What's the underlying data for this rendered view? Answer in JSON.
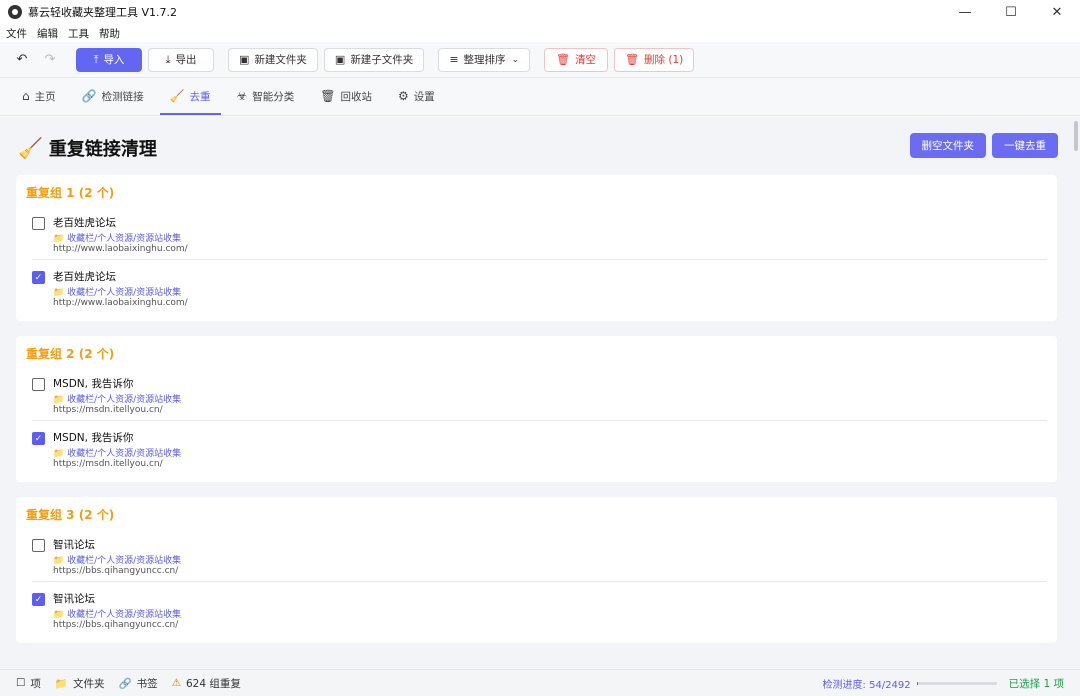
{
  "window": {
    "title": "慕云轻收藏夹整理工具 V1.7.2"
  },
  "menu": [
    "文件",
    "编辑",
    "工具",
    "帮助"
  ],
  "toolbar": {
    "undo": "↶",
    "redo": "↷",
    "import": "导入",
    "export": "导出",
    "new_folder": "新建文件夹",
    "new_subfolder": "新建子文件夹",
    "sort": "整理排序",
    "clear": "清空",
    "delete": "删除 (1)"
  },
  "tabs": [
    {
      "label": "主页",
      "icon": "home-icon"
    },
    {
      "label": "检测链接",
      "icon": "link-icon"
    },
    {
      "label": "去重",
      "icon": "broom-icon",
      "active": true
    },
    {
      "label": "智能分类",
      "icon": "robot-icon"
    },
    {
      "label": "回收站",
      "icon": "trash-icon"
    },
    {
      "label": "设置",
      "icon": "gear-icon"
    }
  ],
  "page": {
    "title": "重复链接清理",
    "delete_empty_button": "删空文件夹",
    "dedupe_button": "一键去重"
  },
  "groups": [
    {
      "title": "重复组 1 (2 个)",
      "items": [
        {
          "title": "老百姓虎论坛",
          "folder": "收藏栏/个人资源/资源站收集",
          "url": "http://www.laobaixinghu.com/",
          "checked": false
        },
        {
          "title": "老百姓虎论坛",
          "folder": "收藏栏/个人资源/资源站收集",
          "url": "http://www.laobaixinghu.com/",
          "checked": true
        }
      ]
    },
    {
      "title": "重复组 2 (2 个)",
      "items": [
        {
          "title": "MSDN, 我告诉你",
          "folder": "收藏栏/个人资源/资源站收集",
          "url": "https://msdn.itellyou.cn/",
          "checked": false
        },
        {
          "title": "MSDN, 我告诉你",
          "folder": "收藏栏/个人资源/资源站收集",
          "url": "https://msdn.itellyou.cn/",
          "checked": true
        }
      ]
    },
    {
      "title": "重复组 3 (2 个)",
      "items": [
        {
          "title": "智讯论坛",
          "folder": "收藏栏/个人资源/资源站收集",
          "url": "https://bbs.qihangyuncc.cn/",
          "checked": false
        },
        {
          "title": "智讯论坛",
          "folder": "收藏栏/个人资源/资源站收集",
          "url": "https://bbs.qihangyuncc.cn/",
          "checked": true
        }
      ]
    }
  ],
  "status": {
    "items": "项",
    "folders": "文件夹",
    "bookmarks": "书签",
    "duplicates": "624 组重复",
    "progress_label": "检测进度: 54/2492",
    "progress": 0.0217,
    "selected": "已选择 1 项"
  },
  "colors": {
    "accent": "#6366f1",
    "group_title": "#f59e0b",
    "danger": "#e53935",
    "success": "#16a34a"
  }
}
